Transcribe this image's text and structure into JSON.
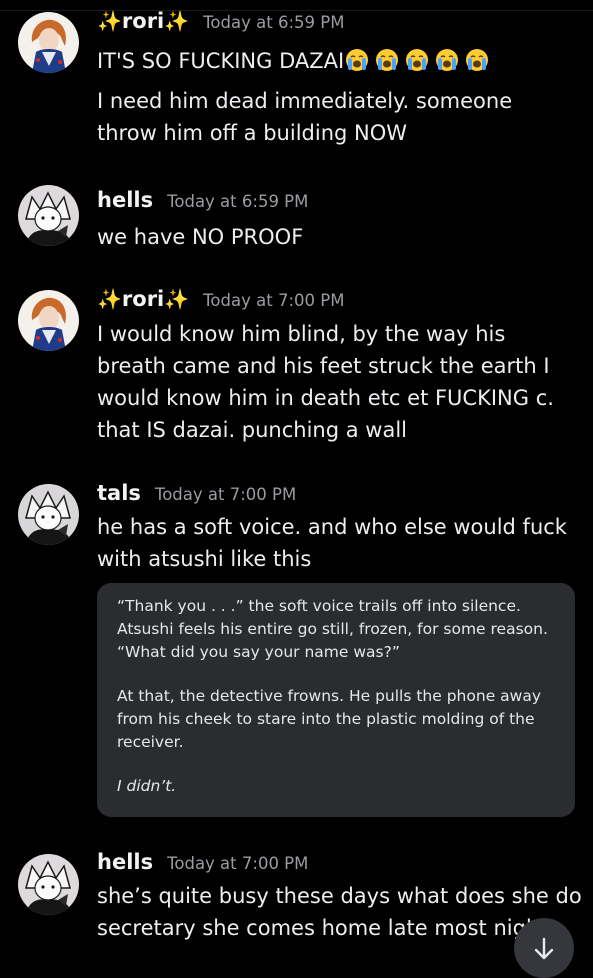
{
  "colors": {
    "background": "#000000",
    "username": "#f2f3f5",
    "timestamp": "#9a9ca2",
    "sparkle": "#f7c326",
    "embed_background": "#2b2c30"
  },
  "sparkle_glyph": "✨",
  "emoji": {
    "name": "loudly-crying-face",
    "count": 5
  },
  "messages": [
    {
      "author": "rori",
      "author_decoration": "sparkles",
      "avatar": "orange-haired-character-avatar",
      "timestamp": "Today at 6:59 PM",
      "line1": "IT'S SO FUCKING DAZAI",
      "line2": "I need him dead immediately. someone throw him off a building NOW"
    },
    {
      "author": "hells",
      "avatar": "white-haired-character-avatar",
      "timestamp": "Today at 6:59 PM",
      "text": "we have NO PROOF"
    },
    {
      "author": "rori",
      "author_decoration": "sparkles",
      "avatar": "orange-haired-character-avatar",
      "timestamp": "Today at 7:00 PM",
      "text": "I would know him blind, by the way his breath came and his feet struck the earth I would know him in death etc et FUCKING c. that IS dazai. punching a wall"
    },
    {
      "author": "tals",
      "avatar": "white-haired-character-avatar",
      "timestamp": "Today at 7:00 PM",
      "text": "he has a soft voice. and who else would fuck with atsushi like this",
      "embed": {
        "para1": "“Thank you . . .” the soft voice trails off into silence. Atsushi feels his entire go still, frozen, for some reason. “What did you say your name was?”",
        "para2": "At that, the detective frowns. He pulls the phone away from his cheek to stare into the plastic molding of the receiver.",
        "para3": "I didn’t."
      }
    },
    {
      "author": "hells",
      "avatar": "white-haired-character-avatar",
      "timestamp": "Today at 7:00 PM",
      "text_line1": "she’s quite busy these days what does she do",
      "text_line2": "secretary she comes home late most nigh"
    }
  ],
  "jump_button_icon": "arrow-down-icon"
}
